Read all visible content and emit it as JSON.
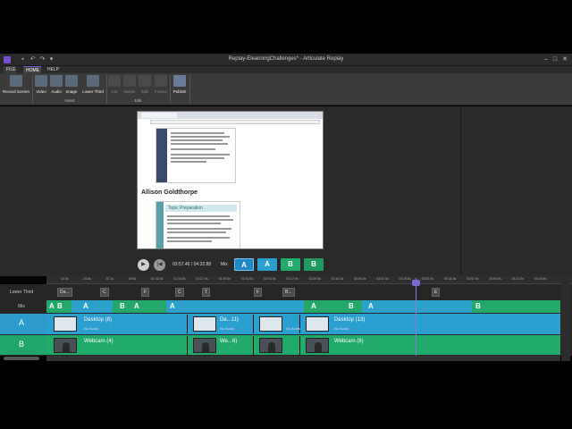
{
  "window": {
    "title": "Replay-ElearningChallenges* - Articulate Replay"
  },
  "tabs": [
    "FILE",
    "HOME",
    "HELP"
  ],
  "ribbon": {
    "buttons": [
      {
        "label": "Record Screen",
        "icon": "record-screen-icon"
      },
      {
        "label": "Video",
        "icon": "video-icon"
      },
      {
        "label": "Audio",
        "icon": "audio-icon"
      },
      {
        "label": "Image",
        "icon": "image-icon"
      },
      {
        "label": "Lower Third",
        "icon": "lower-third-icon"
      },
      {
        "label": "Cut",
        "icon": "cut-icon"
      },
      {
        "label": "Delete",
        "icon": "delete-icon"
      },
      {
        "label": "Split",
        "icon": "split-icon"
      },
      {
        "label": "Freeze",
        "icon": "freeze-icon"
      },
      {
        "label": "Publish",
        "icon": "publish-icon"
      }
    ],
    "groups": {
      "insert": "Insert",
      "edit": "Edit"
    }
  },
  "preview": {
    "person_name": "Allison Goldthorpe",
    "slide_title": "Topic Preparation"
  },
  "playback": {
    "timecode": "03:57.46 / 04:32.88",
    "mix_label": "Mix",
    "mix_buttons": [
      "A",
      "A",
      "B",
      "B"
    ]
  },
  "timeline": {
    "ticks": [
      "12.0s",
      "24.5s",
      "37.1s",
      "49.5s",
      "01:02.0s",
      "01:14.5s",
      "01:27.0s",
      "01:39.5s",
      "01:52.0s",
      "02:04.5s",
      "02:17.0s",
      "02:29.5s",
      "02:42.0s",
      "02:54.5s",
      "03:07.0s",
      "03:19.5s",
      "03:32.0s",
      "03:44.5s",
      "03:57.0s",
      "04:09.5s",
      "04:22.0s",
      "04:34.5s"
    ],
    "lane_labels": {
      "lower_third": "Lower Third",
      "mix": "Mix",
      "a": "A",
      "b": "B"
    },
    "lower_third_markers": [
      "Da...",
      "C",
      "F",
      "C",
      "T",
      "F",
      "B...",
      "E"
    ],
    "mix_letters": [
      "A",
      "B",
      "A",
      "B",
      "A",
      "A",
      "A",
      "B",
      "A",
      "B"
    ],
    "track_a": [
      {
        "title": "Desktop (8)",
        "sub": "No Audio"
      },
      {
        "title": "De...11)",
        "sub": "No Audio"
      },
      {
        "title": "",
        "sub": "No Audio"
      },
      {
        "title": "Desktop (13)",
        "sub": "No Audio"
      }
    ],
    "track_b": [
      {
        "title": "Webcam (4)",
        "sub": ""
      },
      {
        "title": "We...6)",
        "sub": ""
      },
      {
        "title": "",
        "sub": ""
      },
      {
        "title": "Webcam (8)",
        "sub": ""
      }
    ]
  }
}
